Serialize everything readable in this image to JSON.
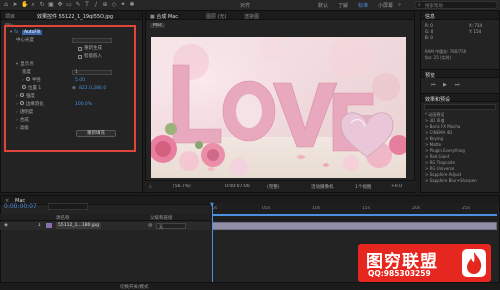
{
  "toolbar": {
    "workspaces": [
      "默认",
      "了解",
      "标准",
      "小屏幕"
    ],
    "active_workspace": "标准",
    "snap_label": "对齐",
    "search_placeholder": "搜索帮助"
  },
  "effect_controls": {
    "tab_project": "项目",
    "tab_effects": "效果控件 55122_1_19qI55O.jpg",
    "header": "Mo-",
    "effect_name": "AutoFill",
    "rows": [
      {
        "label": "中心光度"
      },
      {
        "label": "显示点"
      },
      {
        "label": "宽度",
        "value": "1"
      },
      {
        "label": "半径",
        "value": "5.00"
      },
      {
        "label": "位置 1",
        "value": "822.0,286.0"
      },
      {
        "label": "强度"
      },
      {
        "label": "边缘羽化",
        "value": "100.0%"
      },
      {
        "label": "透明度"
      },
      {
        "label": "合成"
      },
      {
        "label": "高级"
      }
    ],
    "checkbox_1": "重新生成",
    "checkbox_2": "智能嵌入",
    "reset_button": "重新填充"
  },
  "viewer": {
    "tab_label": "合成 Mac",
    "tab_layer": "图层 (无)",
    "tab_footage": "渲染图",
    "comp_chip": "Mac",
    "image_text": "LOVE",
    "bottom_bar": [
      "(56.7%)",
      "0:00:07:00",
      "(完整)",
      "活动摄像机",
      "1个视图",
      "+0.0"
    ]
  },
  "info_panel": {
    "title": "信息",
    "x_label": "X: 734",
    "y_label": "Y: 154",
    "r_label": "R: 0",
    "g_label": "G: 0",
    "b_label": "B: 0",
    "raw_label": "RAM 中缓存: 780/750",
    "fps_label": "fps: 25 (实时)"
  },
  "preview_panel": {
    "title": "预览"
  },
  "effects_presets": {
    "title": "效果和预设",
    "items": [
      "* 动画预设",
      "> 3D 声道",
      "> Boris FX Mocha",
      "> CINEMA 4D",
      "> Keying",
      "> Matte",
      "> Plugin Everything",
      "> Red Giant",
      "> RG Trapcode",
      "> RG Universe",
      "> Sapphire Adjust",
      "> Sapphire Blur+Sharpen"
    ]
  },
  "timeline": {
    "tab": "Mac",
    "timecode": "0:00:00:07",
    "columns": [
      "源名称",
      "父级和链接"
    ],
    "layer_index": "1",
    "layer_name": "55112_1...1B0.jpg",
    "parent_value": "无",
    "ruler_labels": [
      "0s",
      "05s",
      "10s",
      "15s",
      "20s",
      "25s"
    ],
    "footer": "切换开关/模式"
  },
  "watermark": {
    "title": "图穷联盟",
    "qq": "QQ:985303259"
  },
  "colors": {
    "accent_blue": "#4a8fe0",
    "highlight_red": "#e0453a",
    "watermark_red": "#e5271f"
  }
}
